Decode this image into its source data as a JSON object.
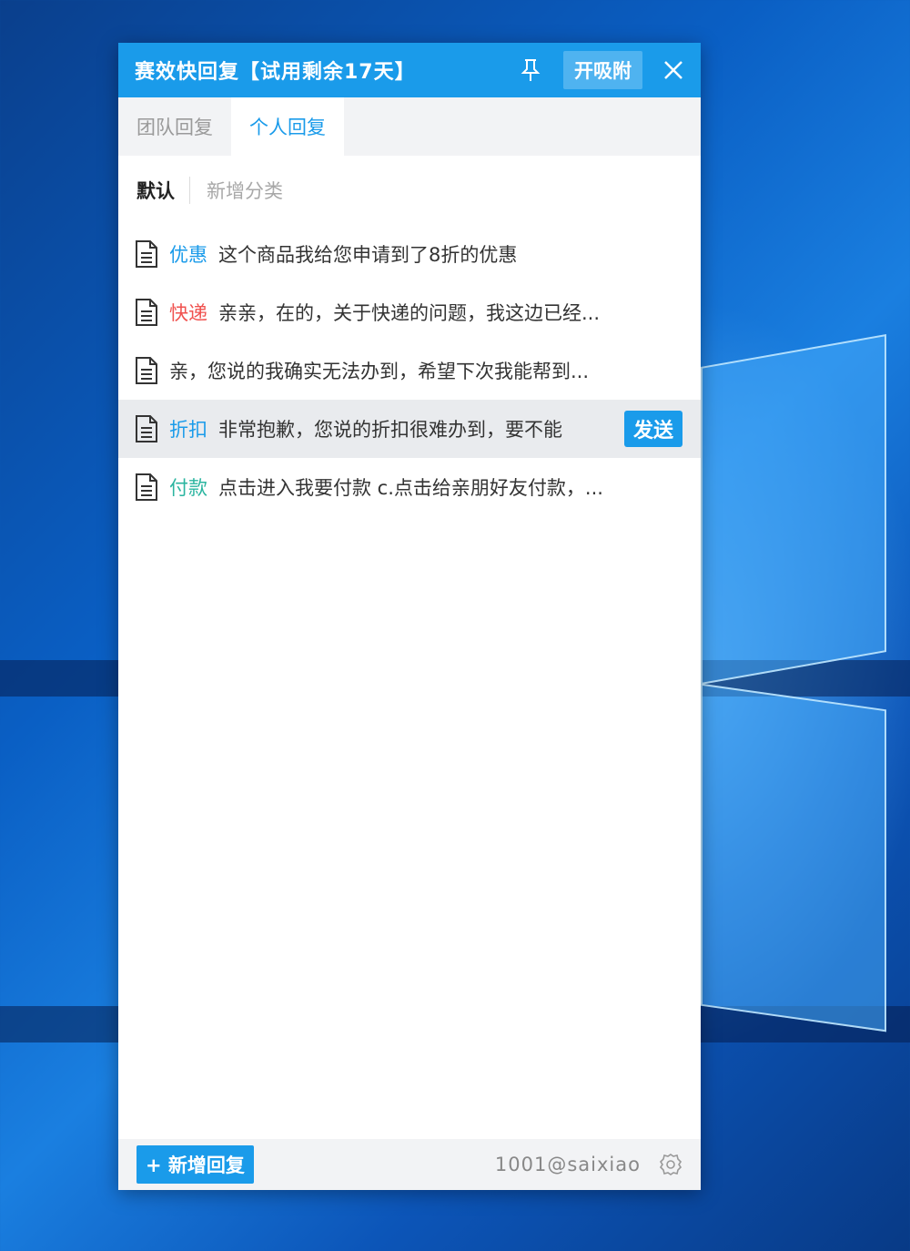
{
  "window": {
    "title": "赛效快回复【试用剩余17天】",
    "attach_label": "开吸附"
  },
  "tabs": [
    {
      "label": "团队回复",
      "active": false
    },
    {
      "label": "个人回复",
      "active": true
    }
  ],
  "categories": {
    "default_label": "默认",
    "add_label": "新增分类"
  },
  "replies": [
    {
      "tag": "优惠",
      "tag_color": "#1a9bea",
      "text": "这个商品我给您申请到了8折的优惠"
    },
    {
      "tag": "快递",
      "tag_color": "#f0524f",
      "text": "亲亲，在的，关于快递的问题，我这边已经..."
    },
    {
      "tag": "",
      "tag_color": "",
      "text": "亲，您说的我确实无法办到，希望下次我能帮到..."
    },
    {
      "tag": "折扣",
      "tag_color": "#1a9bea",
      "text": "非常抱歉，您说的折扣很难办到，要不能"
    },
    {
      "tag": "付款",
      "tag_color": "#2bb5a0",
      "text": "点击进入我要付款 c.点击给亲朋好友付款，..."
    }
  ],
  "send_label": "发送",
  "footer": {
    "add_reply_label": "+ 新增回复",
    "user": "1001@saixiao"
  },
  "icons": {
    "pin": "pin-icon",
    "close": "close-icon",
    "doc": "document-icon",
    "gear": "gear-icon"
  },
  "colors": {
    "accent": "#1a9bea",
    "highlight_row": "#e9ebee"
  }
}
